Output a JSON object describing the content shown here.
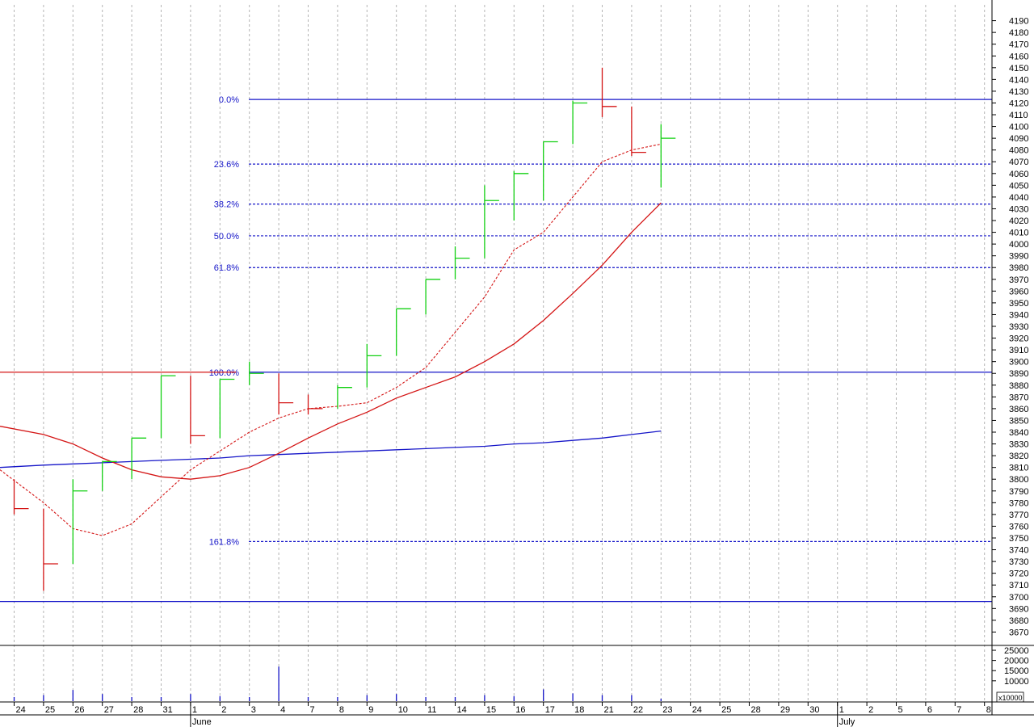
{
  "chart_data": {
    "type": "ohlc",
    "categories": [
      "24",
      "25",
      "26",
      "27",
      "28",
      "31",
      "1",
      "2",
      "3",
      "4",
      "7",
      "8",
      "9",
      "10",
      "11",
      "14",
      "15",
      "16",
      "17",
      "18",
      "21",
      "22",
      "23"
    ],
    "future_categories": [
      "24",
      "25",
      "28",
      "29",
      "30",
      "1",
      "2",
      "5",
      "6",
      "7",
      "8"
    ],
    "months": [
      {
        "label": "June",
        "at": "1"
      },
      {
        "label": "July",
        "at": "1 (July)"
      }
    ],
    "ohlc": [
      {
        "x": "24",
        "open": 3805,
        "high": 3800,
        "low": 3770,
        "close": 3775
      },
      {
        "x": "25",
        "open": 3775,
        "high": 3775,
        "low": 3705,
        "close": 3728
      },
      {
        "x": "26",
        "open": 3728,
        "high": 3800,
        "low": 3728,
        "close": 3790
      },
      {
        "x": "27",
        "open": 3790,
        "high": 3815,
        "low": 3790,
        "close": 3815
      },
      {
        "x": "28",
        "open": 3815,
        "high": 3835,
        "low": 3800,
        "close": 3835
      },
      {
        "x": "31",
        "open": 3835,
        "high": 3888,
        "low": 3835,
        "close": 3888
      },
      {
        "x": "1",
        "open": 3888,
        "high": 3888,
        "low": 3830,
        "close": 3837
      },
      {
        "x": "2",
        "open": 3837,
        "high": 3885,
        "low": 3835,
        "close": 3885
      },
      {
        "x": "3",
        "open": 3885,
        "high": 3900,
        "low": 3880,
        "close": 3890
      },
      {
        "x": "4",
        "open": 3890,
        "high": 3890,
        "low": 3855,
        "close": 3865
      },
      {
        "x": "7",
        "open": 3865,
        "high": 3872,
        "low": 3855,
        "close": 3860
      },
      {
        "x": "8",
        "open": 3860,
        "high": 3880,
        "low": 3860,
        "close": 3878
      },
      {
        "x": "9",
        "open": 3878,
        "high": 3915,
        "low": 3878,
        "close": 3905
      },
      {
        "x": "10",
        "open": 3905,
        "high": 3945,
        "low": 3905,
        "close": 3945
      },
      {
        "x": "11",
        "open": 3945,
        "high": 3970,
        "low": 3940,
        "close": 3970
      },
      {
        "x": "14",
        "open": 3970,
        "high": 3998,
        "low": 3970,
        "close": 3988
      },
      {
        "x": "15",
        "open": 3988,
        "high": 4050,
        "low": 3988,
        "close": 4037
      },
      {
        "x": "16",
        "open": 4037,
        "high": 4062,
        "low": 4020,
        "close": 4060
      },
      {
        "x": "17",
        "open": 4060,
        "high": 4087,
        "low": 4037,
        "close": 4087
      },
      {
        "x": "18",
        "open": 4087,
        "high": 4122,
        "low": 4085,
        "close": 4120
      },
      {
        "x": "21",
        "open": 4120,
        "high": 4150,
        "low": 4108,
        "close": 4117
      },
      {
        "x": "22",
        "open": 4117,
        "high": 4117,
        "low": 4075,
        "close": 4078
      },
      {
        "x": "23",
        "open": 4078,
        "high": 4102,
        "low": 4048,
        "close": 4090
      }
    ],
    "ma_short": [
      3808,
      3780,
      3758,
      3752,
      3762,
      3785,
      3808,
      3824,
      3840,
      3852,
      3860,
      3862,
      3865,
      3878,
      3895,
      3925,
      3955,
      3995,
      4010,
      4040,
      4070,
      4080,
      4085
    ],
    "ma_medium": [
      3845,
      3838,
      3830,
      3818,
      3808,
      3802,
      3800,
      3803,
      3810,
      3822,
      3835,
      3847,
      3857,
      3869,
      3878,
      3887,
      3900,
      3915,
      3935,
      3958,
      3982,
      4010,
      4035
    ],
    "ma_long": [
      3810,
      3812,
      3813,
      3814,
      3815,
      3816,
      3817,
      3818,
      3820,
      3821,
      3822,
      3823,
      3824,
      3825,
      3826,
      3827,
      3828,
      3830,
      3831,
      3833,
      3835,
      3838,
      3841
    ],
    "horizontal_levels": [
      {
        "label": "0.0%",
        "value": 4123,
        "style": "solid",
        "color": "#1515c8"
      },
      {
        "label": "23.6%",
        "value": 4068,
        "style": "dashed",
        "color": "#1515c8"
      },
      {
        "label": "38.2%",
        "value": 4034,
        "style": "dashed",
        "color": "#1515c8"
      },
      {
        "label": "50.0%",
        "value": 4007,
        "style": "dashed",
        "color": "#1515c8"
      },
      {
        "label": "61.8%",
        "value": 3980,
        "style": "dashed",
        "color": "#1515c8"
      },
      {
        "label": "100.0%",
        "value": 3891,
        "style": "solid",
        "color": "#1515c8"
      },
      {
        "label": "161.8%",
        "value": 3747,
        "style": "dashed",
        "color": "#1515c8"
      },
      {
        "label": "",
        "value": 3696,
        "style": "solid",
        "color": "#1515c8"
      }
    ],
    "resistance_line": {
      "value": 3891,
      "from": "24",
      "to": "2",
      "color": "#d41515"
    },
    "ylim": [
      3660,
      4195
    ],
    "y_ticks": [
      3670,
      3680,
      3690,
      3700,
      3710,
      3720,
      3730,
      3740,
      3750,
      3760,
      3770,
      3780,
      3790,
      3800,
      3810,
      3820,
      3830,
      3840,
      3850,
      3860,
      3870,
      3880,
      3890,
      3900,
      3910,
      3920,
      3930,
      3940,
      3950,
      3960,
      3970,
      3980,
      3990,
      4000,
      4010,
      4020,
      4030,
      4040,
      4050,
      4060,
      4070,
      4080,
      4090,
      4100,
      4110,
      4120,
      4130,
      4140,
      4150,
      4160,
      4170,
      4180,
      4190
    ],
    "volume": {
      "values": [
        2000,
        3000,
        5500,
        3500,
        2000,
        2000,
        3500,
        2500,
        2000,
        17000,
        2000,
        2000,
        3000,
        3500,
        2000,
        2000,
        3000,
        2500,
        5800,
        3800,
        3000,
        3000,
        1200
      ],
      "ylim": [
        0,
        27000
      ],
      "y_ticks": [
        10000,
        15000,
        20000,
        25000
      ],
      "unit_label": "x10000"
    },
    "grid": true,
    "colors": {
      "up": "#12d012",
      "down": "#d41515",
      "fib": "#1515c8",
      "ma": "#d41515",
      "ma_long": "#1515c8"
    }
  }
}
